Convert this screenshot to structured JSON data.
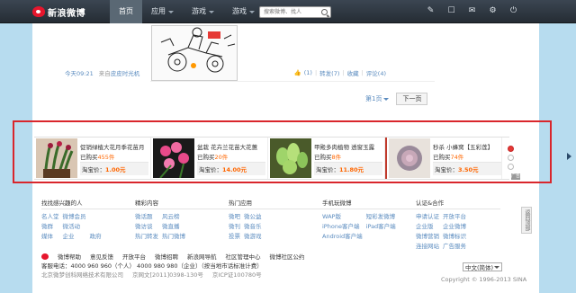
{
  "nav": {
    "logo_text": "新浪微博",
    "items": [
      {
        "label": "首页",
        "active": true
      },
      {
        "label": "应用",
        "active": false
      },
      {
        "label": "游戏",
        "active": false
      },
      {
        "label": "游戏",
        "active": false
      }
    ],
    "ghost_text": "",
    "search_placeholder": "搜索微博、找人",
    "icons": [
      "edit-icon",
      "message-icon",
      "mail-icon",
      "gear-icon",
      "power-icon"
    ]
  },
  "feed": {
    "time": "今天09:21",
    "from_prefix": "来自",
    "from_link": "皮皮时光机",
    "like_count": "(1)",
    "repost": "转发(7)",
    "favorite": "收藏",
    "comment": "评论(4)"
  },
  "pager": {
    "page": "第1页",
    "next": "下一页"
  },
  "ads": [
    {
      "title": "促销绿植大花月季花苗月",
      "sold_prefix": "已购买",
      "sold": "455件",
      "price_label": "淘宝价：",
      "price": "1.00元"
    },
    {
      "title": "盆栽 花卉兰花苗大花蕙",
      "sold_prefix": "已购买",
      "sold": "20件",
      "price_label": "淘宝价：",
      "price": "14.00元"
    },
    {
      "title": "甲殿多肉植物 透窗玉露",
      "sold_prefix": "已购买",
      "sold": "8件",
      "price_label": "淘宝价：",
      "price": "11.80元"
    },
    {
      "title": "秒杀 小蜂窝【五彩莲】",
      "sold_prefix": "已购买",
      "sold": "74件",
      "price_label": "淘宝价：",
      "price": "3.50元"
    }
  ],
  "footer_cols": [
    {
      "title": "找找感兴趣的人",
      "links": [
        "名人堂",
        "微博会员",
        "微群",
        "微活动",
        "媒体",
        "企业",
        "政府"
      ]
    },
    {
      "title": "精彩内容",
      "links": [
        "微话题",
        "风云榜",
        "微访谈",
        "微直播",
        "热门转发",
        "热门微博"
      ]
    },
    {
      "title": "热门应用",
      "links": [
        "微吧",
        "微公益",
        "微刊",
        "微音乐",
        "投票",
        "微游戏"
      ]
    },
    {
      "title": "手机玩微博",
      "links": [
        "WAP版",
        "短彩发微博",
        "iPhone客户端",
        "iPad客户端",
        "Android客户端"
      ]
    },
    {
      "title": "认证&合作",
      "links": [
        "申请认证",
        "开放平台",
        "企业版",
        "企业微博",
        "微博营销",
        "微博标识",
        "连接网站",
        "广告服务"
      ]
    }
  ],
  "bottom": {
    "row1": [
      "微博帮助",
      "意见反馈",
      "开放平台",
      "微博招聘",
      "新浪网导航",
      "社区管理中心",
      "微博社区公约"
    ],
    "row2": "客服电话：4000 960 960（个人） 4000 980 980（企业）（按当地市话标准计费）",
    "row3": [
      "北京微梦创科网络技术有限公司",
      "京网文[2011]0398-130号",
      "京ICP证100780号"
    ],
    "language": "中文(简体)",
    "copyright": "Copyright © 1996-2013 SINA"
  },
  "side": {
    "back_top": "返回顶部",
    "ad_tag": "广告"
  },
  "colors": {
    "accent": "#5a8bbf",
    "price": "#ff6600",
    "highlight": "#d9262c",
    "nav_bg": "#2f3841"
  }
}
